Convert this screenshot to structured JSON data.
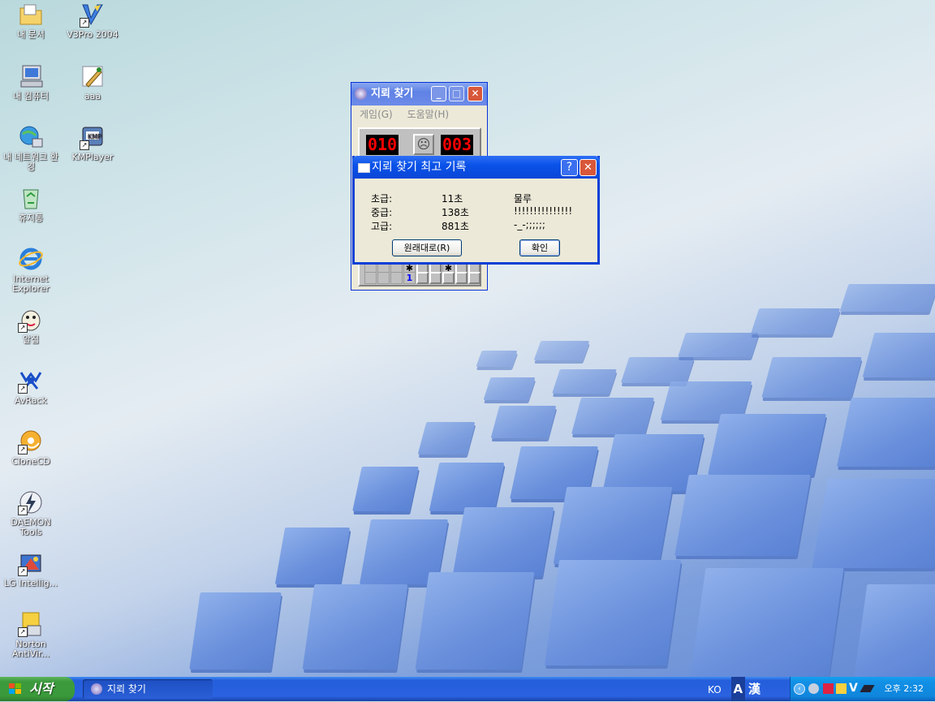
{
  "desktop_icons": [
    {
      "label": "내 문서",
      "icon": "my-documents-icon"
    },
    {
      "label": "V3Pro 2004",
      "icon": "v3pro-icon"
    },
    {
      "label": "내 컴퓨터",
      "icon": "my-computer-icon"
    },
    {
      "label": "aaa",
      "icon": "paint-icon"
    },
    {
      "label": "내 네트워크 환경",
      "icon": "network-icon"
    },
    {
      "label": "KMPlayer",
      "icon": "kmplayer-icon"
    },
    {
      "label": "휴지통",
      "icon": "recycle-bin-icon"
    },
    {
      "label": "Internet Explorer",
      "icon": "internet-explorer-icon"
    },
    {
      "label": "알집",
      "icon": "alzip-icon"
    },
    {
      "label": "AvRack",
      "icon": "avrack-icon"
    },
    {
      "label": "CloneCD",
      "icon": "clonecd-icon"
    },
    {
      "label": "DAEMON Tools",
      "icon": "daemon-tools-icon"
    },
    {
      "label": "LG Intellig...",
      "icon": "lg-intelligent-icon"
    },
    {
      "label": "Norton AntiVir...",
      "icon": "norton-antivirus-icon"
    }
  ],
  "minesweeper": {
    "title": "지뢰 찾기",
    "menu": [
      "게임(G)",
      "도움말(H)"
    ],
    "mine_counter": "010",
    "timer": "003",
    "face": "☹",
    "visible_number": "1"
  },
  "dialog": {
    "title": "지뢰 찾기 최고 기록",
    "help_glyph": "?",
    "close_glyph": "✕",
    "records": [
      {
        "level": "초급:",
        "time": "11초",
        "name": "물루"
      },
      {
        "level": "중급:",
        "time": "138초",
        "name": "!!!!!!!!!!!!!!!"
      },
      {
        "level": "고급:",
        "time": "881초",
        "name": "-_-;;;;;;"
      }
    ],
    "reset_button": "원래대로(R)",
    "ok_button": "확인"
  },
  "taskbar": {
    "start_label": "시작",
    "task_label": "지뢰 찾기",
    "ime_lang": "KO",
    "ime_mode": "A",
    "ime_hanja": "漢",
    "clock": "오후 2:32"
  },
  "colors": {
    "taskbar_blue": "#245edb",
    "start_green": "#3c9a3c",
    "title_blue": "#0a52e8",
    "led_red": "#ff0000"
  }
}
